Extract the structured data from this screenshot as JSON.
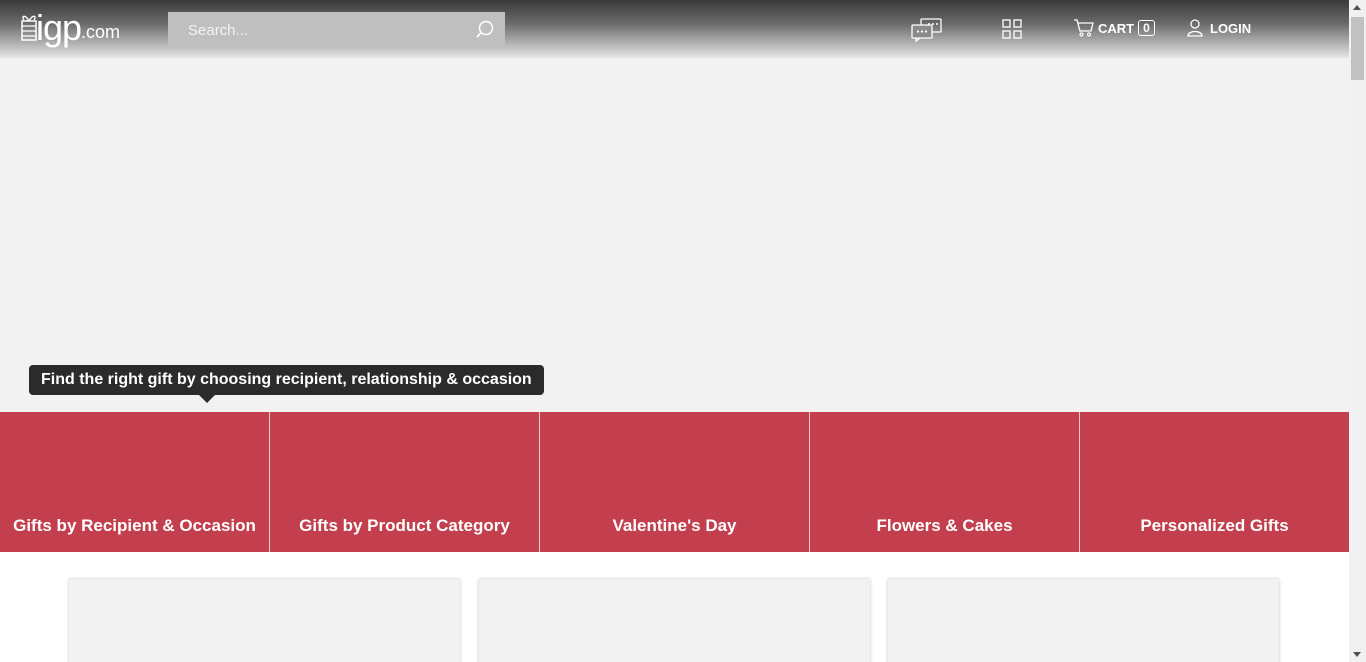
{
  "header": {
    "logo_text": "igp",
    "logo_suffix": ".com",
    "search_placeholder": "Search...",
    "cart_label": "CART",
    "cart_count": "0",
    "login_label": "LOGIN",
    "icons": [
      "gift-logo-icon",
      "search-icon",
      "chat-icon",
      "apps-grid-icon",
      "cart-icon",
      "user-icon"
    ]
  },
  "tooltip": {
    "text": "Find the right gift by choosing recipient, relationship & occasion"
  },
  "categories": [
    {
      "label": "Gifts by Recipient & Occasion"
    },
    {
      "label": "Gifts by Product Category"
    },
    {
      "label": "Valentine's Day"
    },
    {
      "label": "Flowers & Cakes"
    },
    {
      "label": "Personalized Gifts"
    }
  ],
  "colors": {
    "category_bar": "#c33f4d",
    "tooltip_bg": "#2b2b2b",
    "banner_bg": "#f2f2f2"
  }
}
